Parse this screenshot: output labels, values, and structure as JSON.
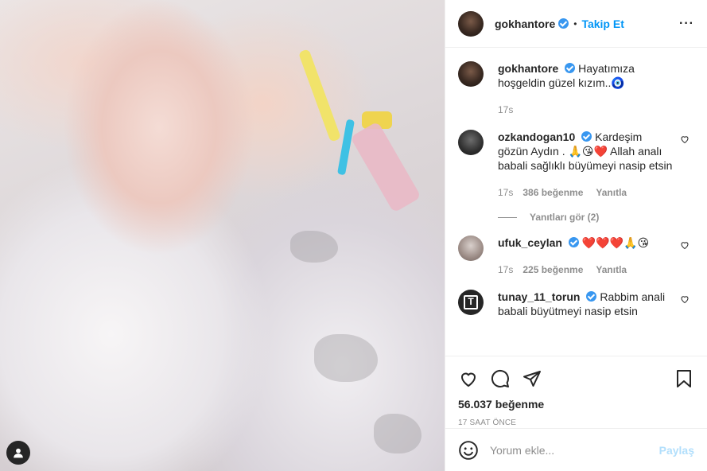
{
  "header": {
    "username": "gokhantore",
    "follow_label": "Takip Et",
    "separator": "•",
    "more_label": "···"
  },
  "caption": {
    "username": "gokhantore",
    "text": "Hayatımıza hoşgeldin güzel kızım..🧿",
    "time": "17s"
  },
  "comments": [
    {
      "username": "ozkandogan10",
      "text": "Kardeşim gözün Aydın . 🙏😘❤️ Allah analı babali sağlıklı büyümeyi nasip etsin",
      "time": "17s",
      "likes": "386 beğenme",
      "reply": "Yanıtla",
      "view_replies": "Yanıtları gör (2)"
    },
    {
      "username": "ufuk_ceylan",
      "text": "❤️❤️❤️🙏😘",
      "time": "17s",
      "likes": "225 beğenme",
      "reply": "Yanıtla"
    },
    {
      "username": "tunay_11_torun",
      "text": "Rabbim anali babali büyütmeyi nasip etsin"
    }
  ],
  "actions": {
    "likes": "56.037 beğenme",
    "timestamp": "17 SAAT ÖNCE"
  },
  "add_comment": {
    "placeholder": "Yorum ekle...",
    "post_label": "Paylaş"
  },
  "icons": [
    "user-tag-icon",
    "verified-badge-icon",
    "heart-icon",
    "comment-icon",
    "share-icon",
    "bookmark-icon",
    "emoji-icon"
  ],
  "colors": {
    "accent": "#0095f6",
    "verified": "#3897f0",
    "muted": "#8e8e8e",
    "text": "#262626"
  }
}
